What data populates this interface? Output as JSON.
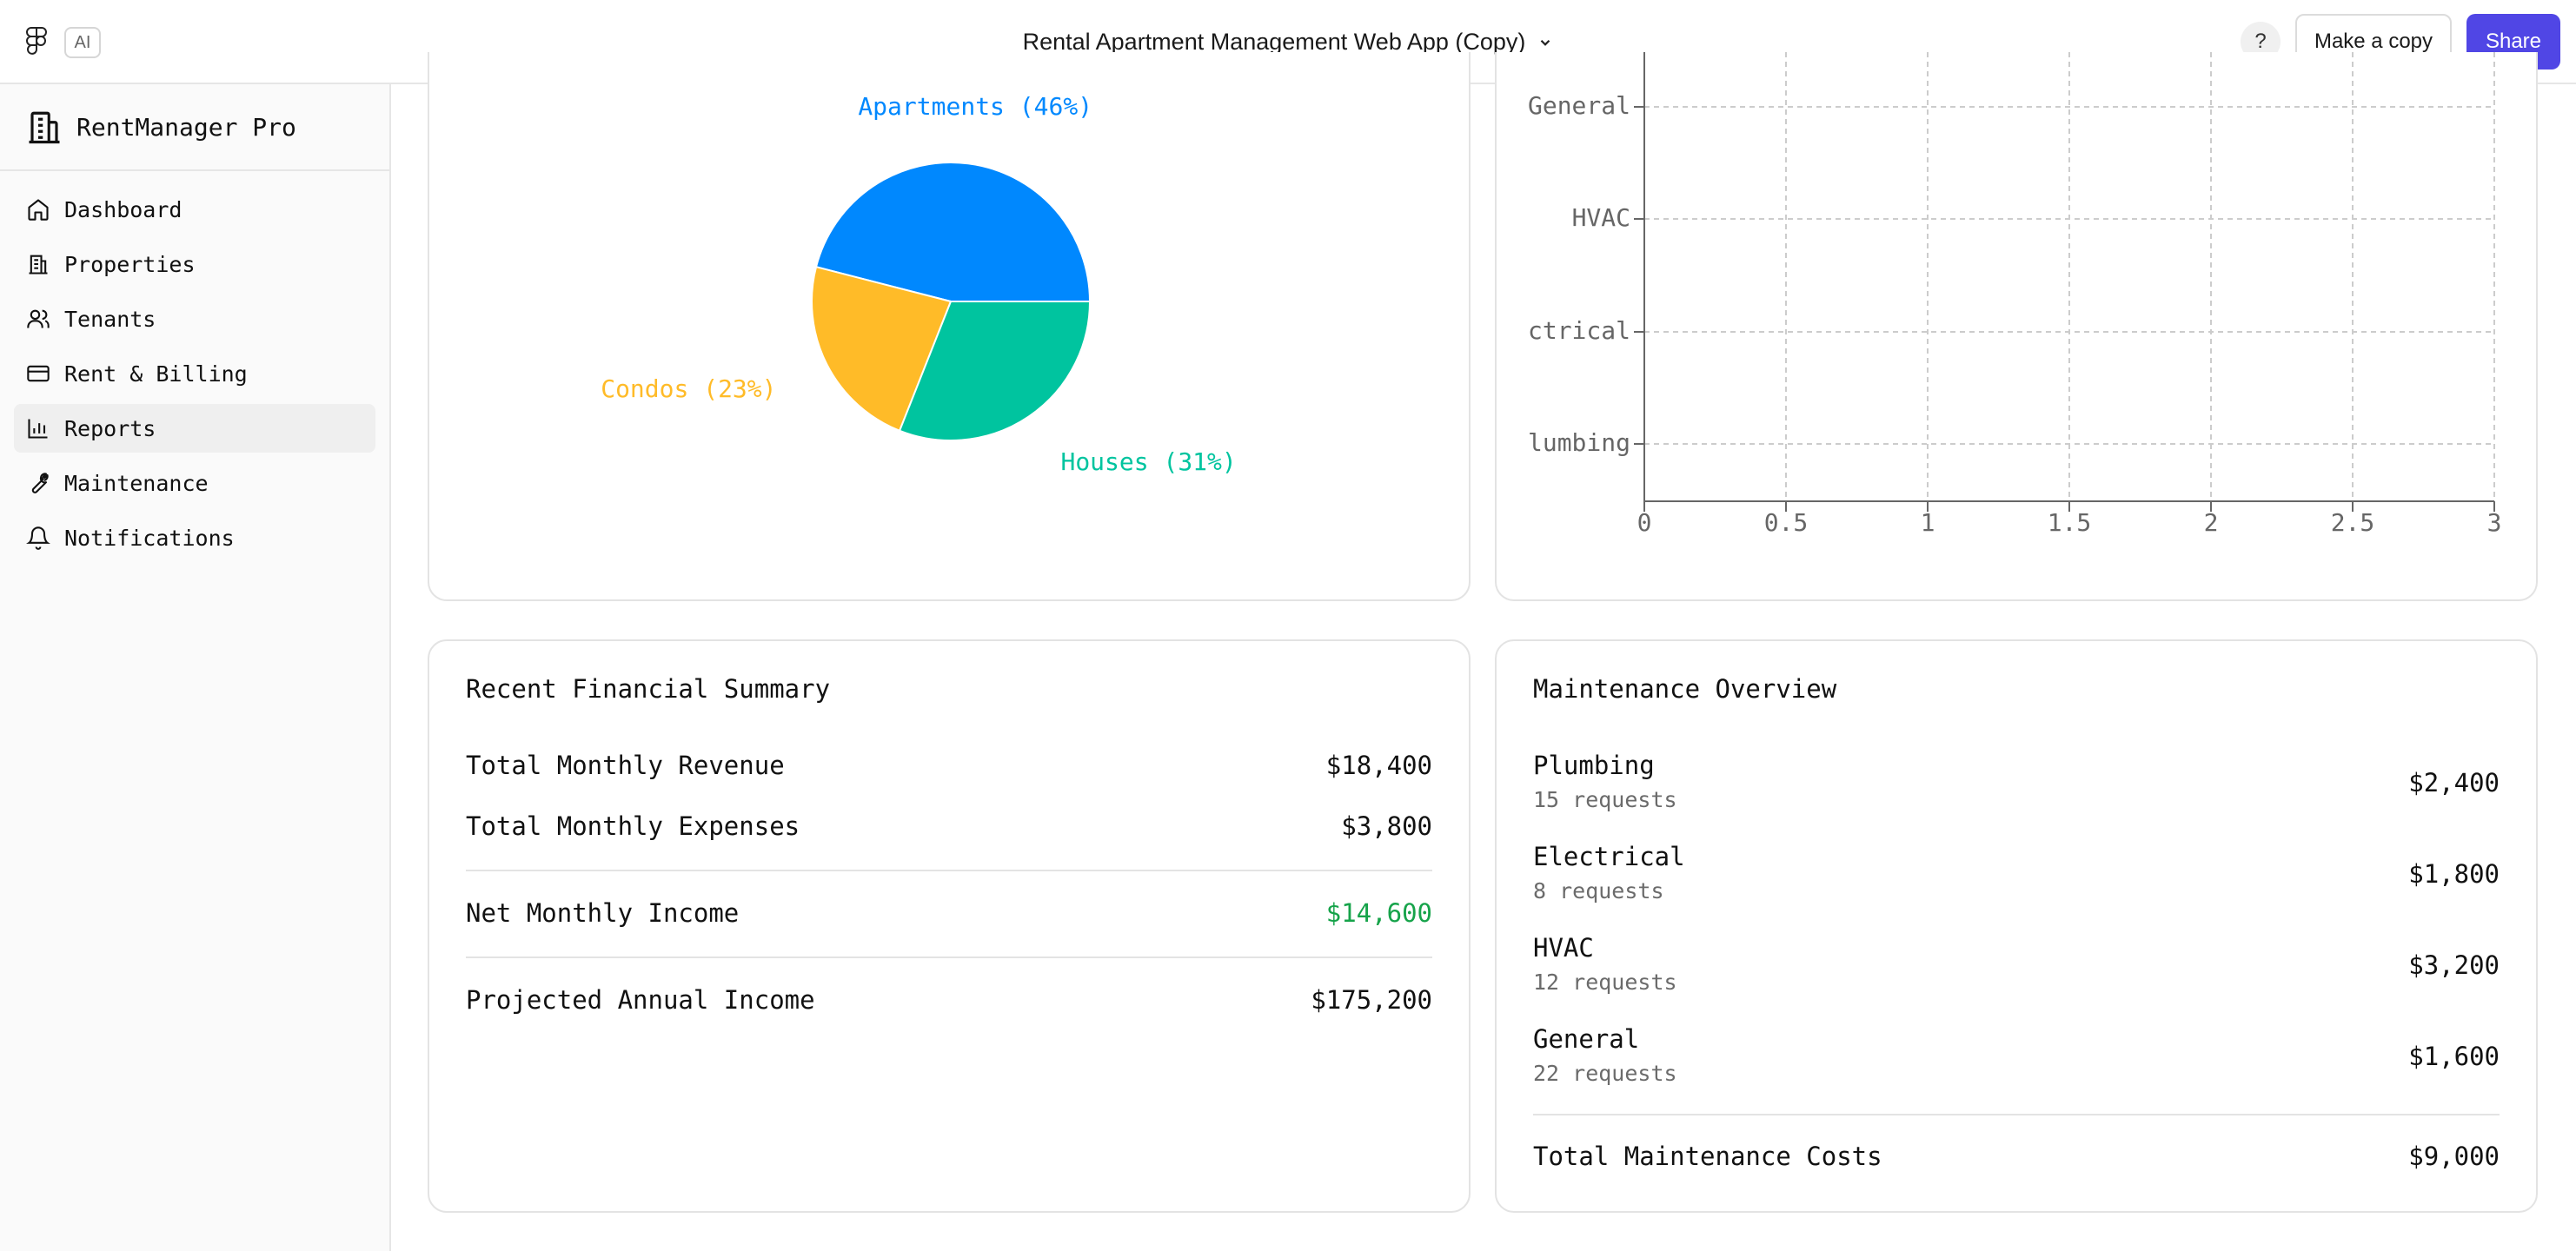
{
  "topbar": {
    "ai_badge": "AI",
    "doc_title": "Rental Apartment Management Web App (Copy)",
    "help_label": "?",
    "make_copy_label": "Make a copy",
    "share_label": "Share"
  },
  "sidebar": {
    "brand": "RentManager Pro",
    "items": [
      {
        "label": "Dashboard",
        "icon": "home-icon",
        "active": false
      },
      {
        "label": "Properties",
        "icon": "building-icon",
        "active": false
      },
      {
        "label": "Tenants",
        "icon": "users-icon",
        "active": false
      },
      {
        "label": "Rent & Billing",
        "icon": "credit-card-icon",
        "active": false
      },
      {
        "label": "Reports",
        "icon": "bar-chart-icon",
        "active": true
      },
      {
        "label": "Maintenance",
        "icon": "wrench-icon",
        "active": false
      },
      {
        "label": "Notifications",
        "icon": "bell-icon",
        "active": false
      }
    ]
  },
  "chart_data": [
    {
      "type": "pie",
      "slices": [
        {
          "label": "Apartments (46%)",
          "value": 46,
          "color": "#0088fe"
        },
        {
          "label": "Condos (23%)",
          "value": 23,
          "color": "#ffbb28"
        },
        {
          "label": "Houses (31%)",
          "value": 31,
          "color": "#00c49f"
        }
      ]
    },
    {
      "type": "bar",
      "orientation": "horizontal",
      "categories": [
        "General",
        "HVAC",
        "ctrical",
        "lumbing"
      ],
      "x_ticks": [
        "0",
        "0.5",
        "1",
        "1.5",
        "2",
        "2.5",
        "3"
      ],
      "xlim": [
        0,
        3
      ],
      "grid": true,
      "values": []
    }
  ],
  "financial": {
    "title": "Recent Financial Summary",
    "revenue_label": "Total Monthly Revenue",
    "revenue_value": "$18,400",
    "expenses_label": "Total Monthly Expenses",
    "expenses_value": "$3,800",
    "net_label": "Net Monthly Income",
    "net_value": "$14,600",
    "net_color": "#16a34a",
    "projected_label": "Projected Annual Income",
    "projected_value": "$175,200"
  },
  "maintenance": {
    "title": "Maintenance Overview",
    "items": [
      {
        "name": "Plumbing",
        "count": "15 requests",
        "cost": "$2,400"
      },
      {
        "name": "Electrical",
        "count": "8 requests",
        "cost": "$1,800"
      },
      {
        "name": "HVAC",
        "count": "12 requests",
        "cost": "$3,200"
      },
      {
        "name": "General",
        "count": "22 requests",
        "cost": "$1,600"
      }
    ],
    "total_label": "Total Maintenance Costs",
    "total_value": "$9,000"
  },
  "colors": {
    "accent": "#5046e5",
    "positive": "#16a34a"
  }
}
